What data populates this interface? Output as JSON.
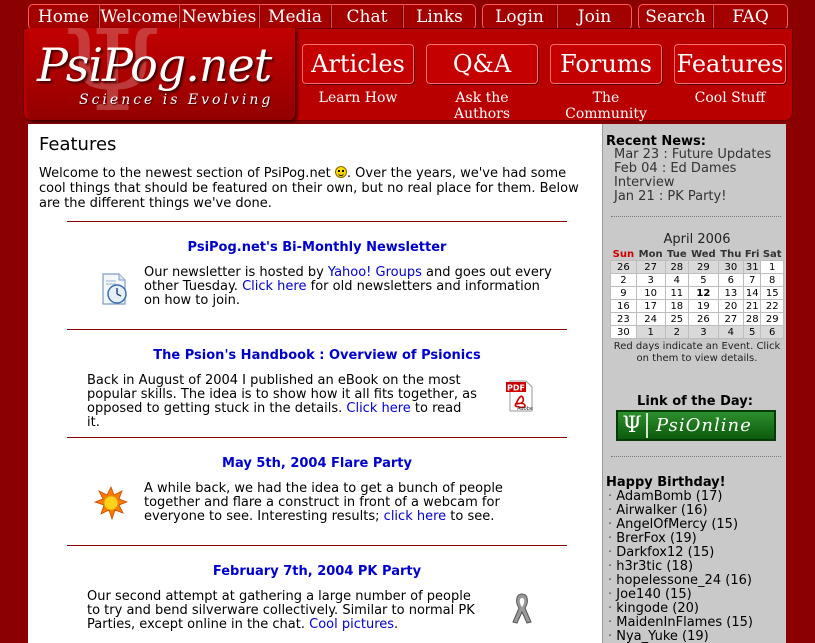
{
  "nav": {
    "group1": [
      "Home",
      "Welcome",
      "Newbies",
      "Media",
      "Chat",
      "Links"
    ],
    "group2": [
      "Login",
      "Join"
    ],
    "group3": [
      "Search",
      "FAQ"
    ]
  },
  "logo": {
    "title": "PsiPog.net",
    "tagline": "Science is Evolving",
    "glyph": "Ψ"
  },
  "tabs": [
    {
      "label": "Articles",
      "sub": "Learn How"
    },
    {
      "label": "Q&A",
      "sub": "Ask the Authors"
    },
    {
      "label": "Forums",
      "sub": "The Community"
    },
    {
      "label": "Features",
      "sub": "Cool Stuff"
    }
  ],
  "main": {
    "heading": "Features",
    "intro_a": "Welcome to the newest section of PsiPog.net ",
    "intro_b": ". Over the years, we've had some cool things that should be featured on their own, but no real place for them. Below are the different things we've done.",
    "sections": [
      {
        "title": "PsiPog.net's Bi-Monthly Newsletter",
        "t1": "Our newsletter is hosted by ",
        "l1": "Yahoo! Groups",
        "t2": " and goes out every other Tuesday. ",
        "l2": "Click here",
        "t3": " for old newsletters and information on how to join.",
        "icon": "clock-document-icon"
      },
      {
        "title": "The Psion's Handbook : Overview of Psionics",
        "t1": "Back in August of 2004 I published an eBook on the most popular skills. The idea is to show how it all fits together, as opposed to getting stuck in the details. ",
        "l1": "Click here",
        "t2": " to read it.",
        "icon": "pdf-icon",
        "pdf_label": "PDF",
        "adobe_label": "Adobe"
      },
      {
        "title": "May 5th, 2004 Flare Party",
        "t1": "A while back, we had the idea to get a bunch of people together and flare a construct in front of a webcam for everyone to see. Interesting results; ",
        "l1": "click here",
        "t2": " to see.",
        "icon": "sun-flare-icon"
      },
      {
        "title": "February 7th, 2004 PK Party",
        "t1": "Our second attempt at gathering a large number of people to try and bend silverware collectively. Similar to normal PK Parties, except online in the chat. ",
        "l1": "Cool pictures",
        "t2": ".",
        "icon": "ribbon-icon"
      }
    ]
  },
  "sidebar": {
    "news_title": "Recent News:",
    "news": [
      "Mar 23 : Future Updates",
      "Feb 04 : Ed Dames Interview",
      "Jan 21 : PK Party!"
    ],
    "calendar": {
      "title": "April 2006",
      "days": [
        "Sun",
        "Mon",
        "Tue",
        "Wed",
        "Thu",
        "Fri",
        "Sat"
      ],
      "weeks": [
        [
          "26",
          "27",
          "28",
          "29",
          "30",
          "31",
          "1"
        ],
        [
          "2",
          "3",
          "4",
          "5",
          "6",
          "7",
          "8"
        ],
        [
          "9",
          "10",
          "11",
          "12",
          "13",
          "14",
          "15"
        ],
        [
          "16",
          "17",
          "18",
          "19",
          "20",
          "21",
          "22"
        ],
        [
          "23",
          "24",
          "25",
          "26",
          "27",
          "28",
          "29"
        ],
        [
          "30",
          "1",
          "2",
          "3",
          "4",
          "5",
          "6"
        ]
      ],
      "note": "Red days indicate an Event. Click on them to view details."
    },
    "lotd_title": "Link of the Day:",
    "lotd_psi": "Ψ",
    "lotd_text": "PsiOnline",
    "bday_title": "Happy Birthday!",
    "birthdays": [
      {
        "name": "AdamBomb",
        "age": "(17)"
      },
      {
        "name": "Airwalker",
        "age": "(16)"
      },
      {
        "name": "AngelOfMercy",
        "age": "(15)"
      },
      {
        "name": "BrerFox",
        "age": "(19)"
      },
      {
        "name": "Darkfox12",
        "age": "(15)"
      },
      {
        "name": "h3r3tic",
        "age": "(18)"
      },
      {
        "name": "hopelessone_24",
        "age": "(16)"
      },
      {
        "name": "Joe140",
        "age": "(15)"
      },
      {
        "name": "kingode",
        "age": "(20)"
      },
      {
        "name": "MaidenInFlames",
        "age": "(15)"
      },
      {
        "name": "Nya_Yuke",
        "age": "(19)"
      }
    ]
  }
}
